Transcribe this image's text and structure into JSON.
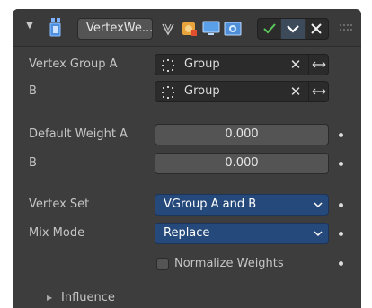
{
  "header": {
    "modifier_name": "VertexWe...",
    "collapse_icon": "triangle-down-icon",
    "modifier_icon": "vertex-weight-modifier-icon",
    "buttons": [
      "vertex-group-filter-icon",
      "edit-mode-icon",
      "realtime-display-icon",
      "render-icon"
    ],
    "toggles": [
      "apply-check-icon",
      "options-chevron-icon",
      "delete-x-icon"
    ]
  },
  "fields": {
    "vertex_group_a": {
      "label": "Vertex Group A",
      "value": "Group"
    },
    "vertex_group_b": {
      "label": "B",
      "value": "Group"
    },
    "default_weight_a": {
      "label": "Default Weight A",
      "value": "0.000"
    },
    "default_weight_b": {
      "label": "B",
      "value": "0.000"
    },
    "vertex_set": {
      "label": "Vertex Set",
      "value": "VGroup A and B"
    },
    "mix_mode": {
      "label": "Mix Mode",
      "value": "Replace"
    },
    "normalize": {
      "label": "Normalize Weights",
      "checked": false
    }
  },
  "subpanel": {
    "label": "Influence",
    "expanded": false
  },
  "colors": {
    "panel_bg": "#3d3d3d",
    "select_bg": "#25497a",
    "check_green": "#5cc85c",
    "number_bg": "#545454"
  }
}
